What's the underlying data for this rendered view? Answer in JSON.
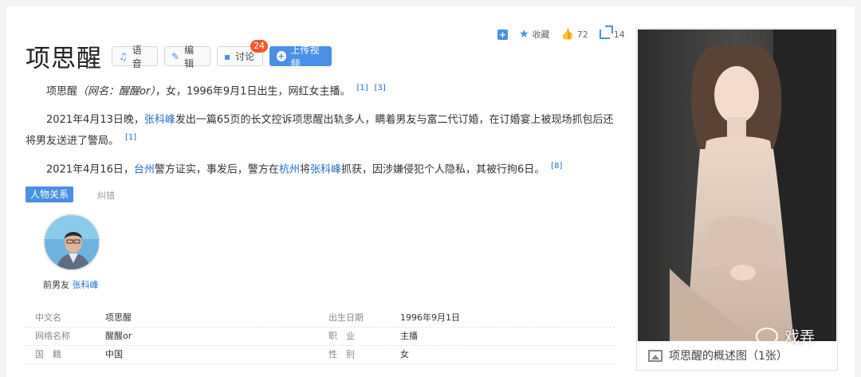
{
  "stats": {
    "collect_label": "收藏",
    "likes": "72",
    "shares": "14"
  },
  "title": "项思醒",
  "buttons": {
    "voice": "语音",
    "edit": "编辑",
    "discuss": "讨论",
    "discuss_badge": "24",
    "upload": "上传视频"
  },
  "paragraphs": {
    "p1_a": "项思醒",
    "p1_alias": "（网名：醒醒or）",
    "p1_b": "，女，1996年9月1日出生，网红女主播。",
    "p1_ref1": "[1]",
    "p1_ref2": "[3]",
    "p2_a": "2021年4月13日晚，",
    "p2_link": "张科峰",
    "p2_b": "发出一篇65页的长文控诉项思醒出轨多人，瞒着男友与富二代订婚，在订婚宴上被现场抓包后还将男友送进了警局。",
    "p2_ref": "[1]",
    "p3_a": "2021年4月16日，",
    "p3_link1": "台州",
    "p3_b": "警方证实，事发后，警方在",
    "p3_link2": "杭州",
    "p3_c": "将",
    "p3_link3": "张科峰",
    "p3_d": "抓获，因涉嫌侵犯个人隐私，其被行拘6日。",
    "p3_ref": "[8]"
  },
  "relations": {
    "tab": "人物关系",
    "correct": "纠错",
    "items": [
      {
        "relation": "前男友",
        "name": "张科峰"
      }
    ]
  },
  "info": [
    {
      "k1": "中文名",
      "v1": "项思醒",
      "k2": "出生日期",
      "v2": "1996年9月1日",
      "v2_link": false
    },
    {
      "k1": "网络名称",
      "v1": "醒醒or",
      "k2": "职　业",
      "v2": "主播",
      "v2_link": true
    },
    {
      "k1": "国　籍",
      "v1": "中国",
      "k2": "性　别",
      "v2": "女",
      "v2_link": false
    }
  ],
  "panel": {
    "caption": "项思醒的概述图（1张）",
    "watermark": "戏弄"
  },
  "colors": {
    "accent": "#4a90e2",
    "link": "#1e6dc1",
    "badge": "#f05a2a"
  }
}
